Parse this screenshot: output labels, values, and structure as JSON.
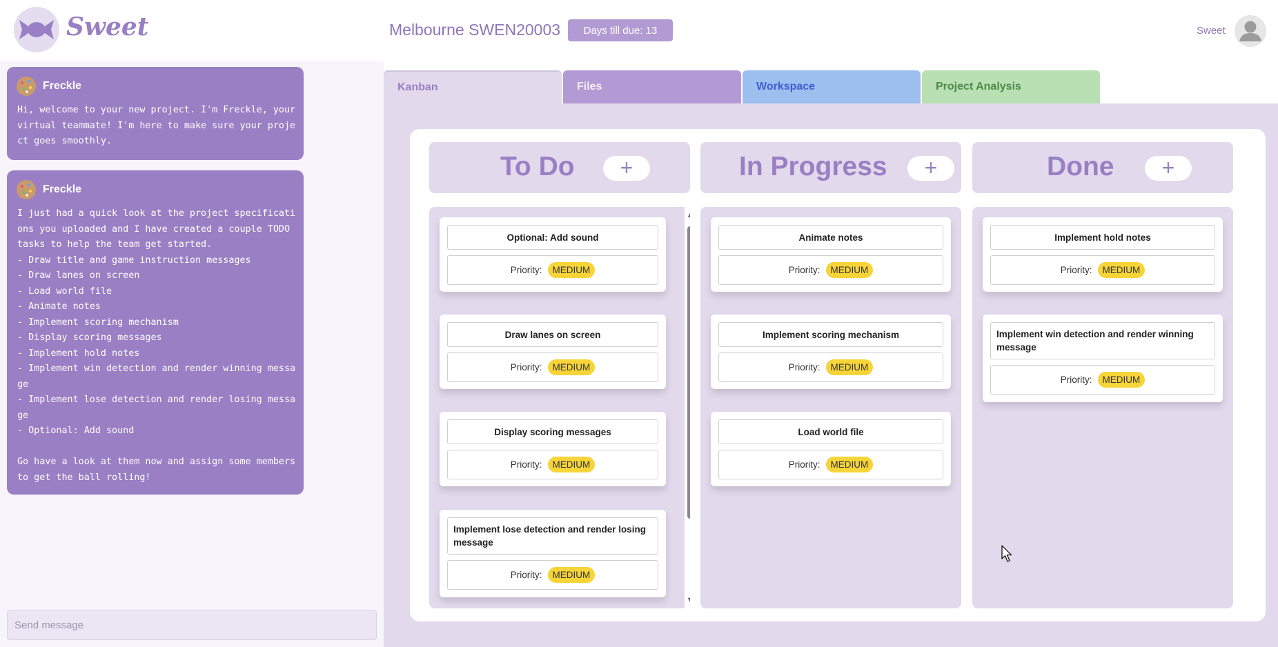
{
  "header": {
    "logo_text": "Sweet",
    "project_name": "Melbourne SWEN20003",
    "due_label": "Days till due: 13",
    "user_name": "Sweet"
  },
  "chat": {
    "messages": [
      {
        "author": "Freckle",
        "text": "Hi, welcome to your new project. I'm Freckle, your virtual teammate! I'm here to make sure your project goes smoothly."
      },
      {
        "author": "Freckle",
        "text": "I just had a quick look at the project specifications you uploaded and I have created a couple TODO tasks to help the team get started.\n- Draw title and game instruction messages\n- Draw lanes on screen\n- Load world file\n- Animate notes\n- Implement scoring mechanism\n- Display scoring messages\n- Implement hold notes\n- Implement win detection and render winning message\n- Implement lose detection and render losing message\n- Optional: Add sound\n\nGo have a look at them now and assign some members to get the ball rolling!"
      }
    ],
    "input_placeholder": "Send message"
  },
  "tabs": [
    {
      "label": "Kanban"
    },
    {
      "label": "Files"
    },
    {
      "label": "Workspace"
    },
    {
      "label": "Project Analysis"
    }
  ],
  "kanban": {
    "add_label": "+",
    "priority_label": "Priority:",
    "columns": [
      {
        "title": "To Do",
        "cards": [
          {
            "title": "Optional: Add sound",
            "priority": "MEDIUM"
          },
          {
            "title": "Draw lanes on screen",
            "priority": "MEDIUM"
          },
          {
            "title": "Display scoring messages",
            "priority": "MEDIUM"
          },
          {
            "title": "Implement lose detection and render losing message",
            "priority": "MEDIUM"
          }
        ]
      },
      {
        "title": "In Progress",
        "cards": [
          {
            "title": "Animate notes",
            "priority": "MEDIUM"
          },
          {
            "title": "Implement scoring mechanism",
            "priority": "MEDIUM"
          },
          {
            "title": "Load world file",
            "priority": "MEDIUM"
          }
        ]
      },
      {
        "title": "Done",
        "cards": [
          {
            "title": "Implement hold notes",
            "priority": "MEDIUM"
          },
          {
            "title": "Implement win detection and render winning message",
            "priority": "MEDIUM"
          }
        ]
      }
    ]
  },
  "colors": {
    "brand_purple": "#9a7fc4",
    "panel_lavender": "#e2d9ec",
    "priority_yellow": "#f7d437",
    "tab_kanban": "#e2d9ec",
    "tab_files": "#b39ad4",
    "tab_workspace": "#9dbff0",
    "tab_analysis": "#b9e0b3"
  },
  "icons": [
    "candy-logo-icon",
    "user-avatar-icon",
    "cookie-avatar-icon",
    "scroll-up-arrow-icon",
    "scroll-down-arrow-icon",
    "mouse-cursor-icon"
  ]
}
